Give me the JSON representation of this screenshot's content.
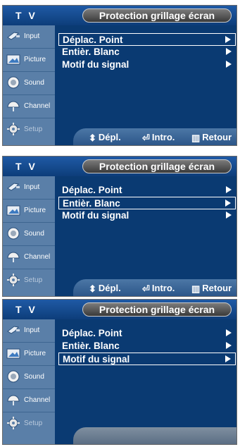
{
  "screens": [
    {
      "header": {
        "tv_label": "T V",
        "title": "Protection grillage écran"
      },
      "sidebar": [
        {
          "label": "Input"
        },
        {
          "label": "Picture"
        },
        {
          "label": "Sound"
        },
        {
          "label": "Channel"
        },
        {
          "label": "Setup"
        }
      ],
      "menu": [
        {
          "label": "Déplac. Point"
        },
        {
          "label": "Entièr. Blanc"
        },
        {
          "label": "Motif du signal"
        }
      ],
      "selected_index": 0,
      "footer": {
        "move": "Dépl.",
        "enter": "Intro.",
        "return": "Retour"
      }
    },
    {
      "header": {
        "tv_label": "T V",
        "title": "Protection grillage écran"
      },
      "sidebar": [
        {
          "label": "Input"
        },
        {
          "label": "Picture"
        },
        {
          "label": "Sound"
        },
        {
          "label": "Channel"
        },
        {
          "label": "Setup"
        }
      ],
      "menu": [
        {
          "label": "Déplac. Point"
        },
        {
          "label": "Entièr. Blanc"
        },
        {
          "label": "Motif du signal"
        }
      ],
      "selected_index": 1,
      "footer": {
        "move": "Dépl.",
        "enter": "Intro.",
        "return": "Retour"
      }
    },
    {
      "header": {
        "tv_label": "T V",
        "title": "Protection grillage écran"
      },
      "sidebar": [
        {
          "label": "Input"
        },
        {
          "label": "Picture"
        },
        {
          "label": "Sound"
        },
        {
          "label": "Channel"
        },
        {
          "label": "Setup"
        }
      ],
      "menu": [
        {
          "label": "Déplac. Point"
        },
        {
          "label": "Entièr. Blanc"
        },
        {
          "label": "Motif du signal"
        }
      ],
      "selected_index": 2,
      "footer": {
        "move": "",
        "enter": "",
        "return": ""
      }
    }
  ],
  "icons": [
    "input-plug-icon",
    "picture-icon",
    "sound-icon",
    "channel-icon",
    "setup-icon",
    "updown-arrow-icon",
    "enter-icon",
    "return-icon"
  ],
  "colors": {
    "background": "#0a3a72",
    "header": "#1f5aa5",
    "sidebar": "#5a7fa8",
    "text": "#ffffff"
  }
}
